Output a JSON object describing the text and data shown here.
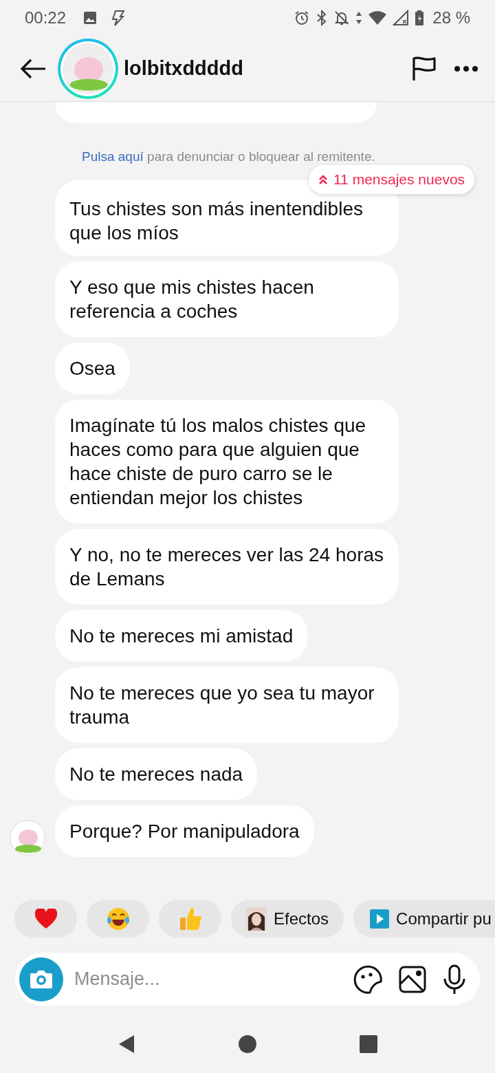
{
  "status_bar": {
    "time": "00:22",
    "battery": "28 %"
  },
  "header": {
    "username": "lolbitxddddd",
    "story_ring": true
  },
  "chat": {
    "top_cut_bubble": true,
    "notice": {
      "link": "Pulsa aquí",
      "text": "para denunciar o bloquear al remitente."
    },
    "new_messages_pill": "11 mensajes nuevos",
    "messages": [
      {
        "text": "Tus chistes son más inentendibles que los míos",
        "avatar": false
      },
      {
        "text": "Y eso que mis chistes hacen referencia a coches",
        "avatar": false
      },
      {
        "text": "Osea",
        "avatar": false
      },
      {
        "text": "Imagínate tú los malos chistes que haces como para que alguien que hace chiste de puro carro se le entiendan mejor los chistes",
        "avatar": false
      },
      {
        "text": "Y no, no te mereces ver las 24 horas de Lemans",
        "avatar": false
      },
      {
        "text": "No te mereces mi amistad",
        "avatar": false
      },
      {
        "text": "No te mereces que yo sea tu mayor trauma",
        "avatar": false
      },
      {
        "text": "No te mereces nada",
        "avatar": false
      },
      {
        "text": "Porque? Por manipuladora",
        "avatar": true
      }
    ]
  },
  "quick_replies": [
    {
      "kind": "heart"
    },
    {
      "kind": "laugh"
    },
    {
      "kind": "thumbs_up"
    },
    {
      "kind": "effects",
      "label": "Efectos"
    },
    {
      "kind": "share",
      "label": "Compartir pu"
    }
  ],
  "composer": {
    "placeholder": "Mensaje..."
  }
}
